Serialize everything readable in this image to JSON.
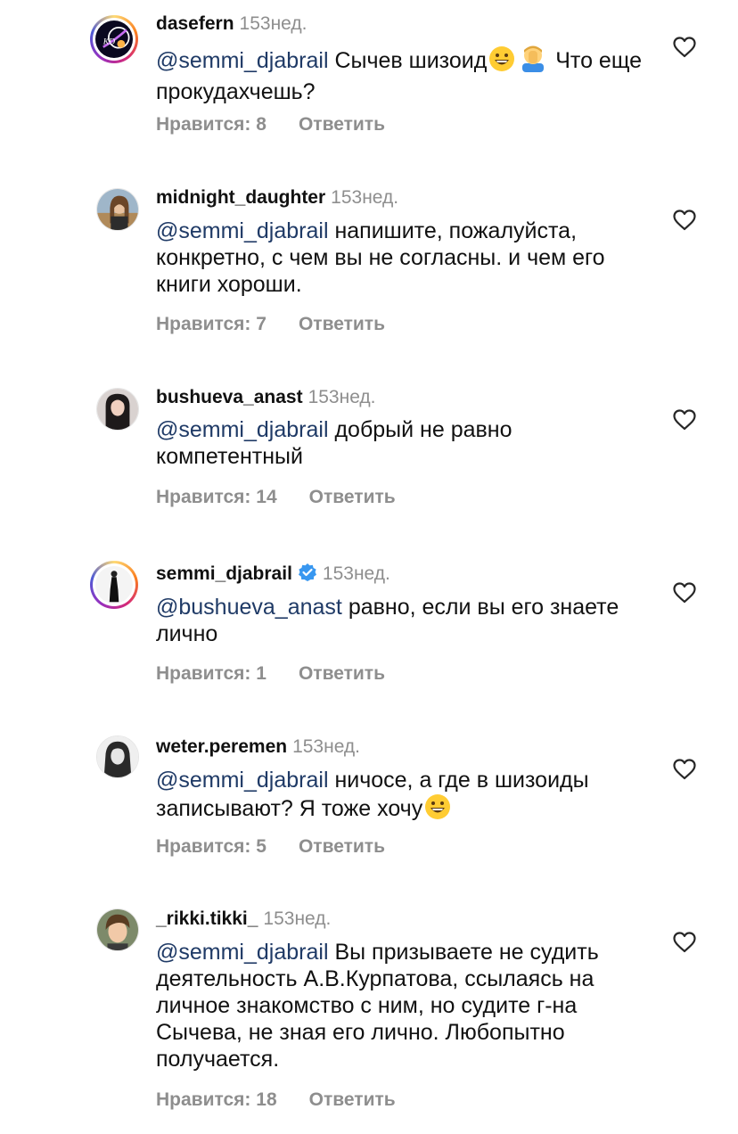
{
  "comments": [
    {
      "username": "dasefern",
      "time": "153нед.",
      "mention": "@semmi_djabrail",
      "text_before": "Сычев шизоид",
      "emojis": [
        "grinning-face",
        "facepalm"
      ],
      "text_after": "Что еще прокудахчешь?",
      "likes_label": "Нравится: 8",
      "reply_label": "Ответить",
      "avatar": "dasefern-avatar",
      "verified": false
    },
    {
      "username": "midnight_daughter",
      "time": "153нед.",
      "mention": "@semmi_djabrail",
      "text_before": "напишите, пожалуйста, конкретно, с чем вы не согласны. и чем его книги хороши.",
      "likes_label": "Нравится: 7",
      "reply_label": "Ответить",
      "avatar": "midnight-daughter-avatar",
      "verified": false
    },
    {
      "username": "bushueva_anast",
      "time": "153нед.",
      "mention": "@semmi_djabrail",
      "text_before": "добрый не равно компетентный",
      "likes_label": "Нравится: 14",
      "reply_label": "Ответить",
      "avatar": "bushueva-anast-avatar",
      "verified": false
    },
    {
      "username": "semmi_djabrail",
      "time": "153нед.",
      "mention": "@bushueva_anast",
      "text_before": "равно, если вы его знаете лично",
      "likes_label": "Нравится: 1",
      "reply_label": "Ответить",
      "avatar": "semmi-djabrail-avatar",
      "verified": true
    },
    {
      "username": "weter.peremen",
      "time": "153нед.",
      "mention": "@semmi_djabrail",
      "text_before": "ничосе, а где в шизоиды записывают? Я тоже хочу",
      "emojis": [
        "grinning-face"
      ],
      "likes_label": "Нравится: 5",
      "reply_label": "Ответить",
      "avatar": "weter-peremen-avatar",
      "verified": false
    },
    {
      "username": "_rikki.tikki_",
      "time": "153нед.",
      "mention": "@semmi_djabrail",
      "text_before": "Вы призываете не судить деятельность А.В.Курпатова,  ссылаясь на личное знакомство с ним, но судите г-на Сычева, не зная его лично. Любопытно получается.",
      "likes_label": "Нравится: 18",
      "reply_label": "Ответить",
      "avatar": "rikki-tikki-avatar",
      "verified": false
    }
  ],
  "colors": {
    "mention": "#1f3a66",
    "meta": "#8e8e8e",
    "verified": "#3897f0"
  }
}
